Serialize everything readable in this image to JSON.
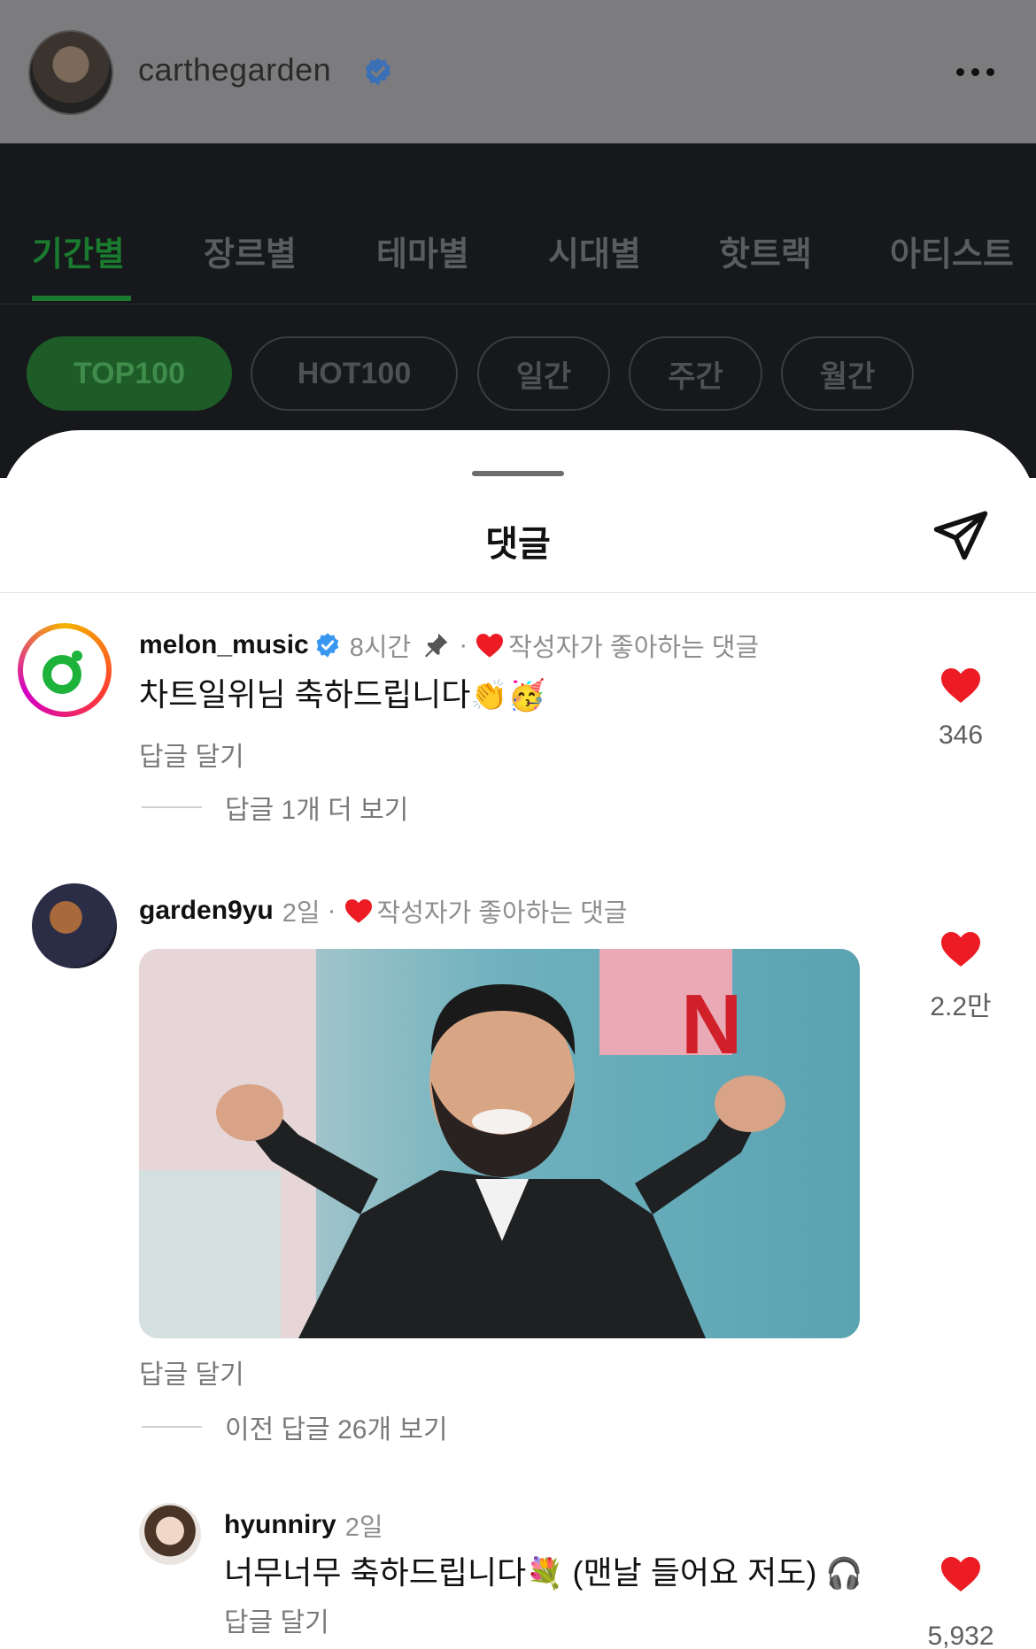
{
  "background": {
    "topbar": {
      "username": "carthegarden"
    },
    "tabs": [
      "기간별",
      "장르별",
      "테마별",
      "시대별",
      "핫트랙",
      "아티스트"
    ],
    "active_tab": 0,
    "pills": [
      "TOP100",
      "HOT100",
      "일간",
      "주간",
      "월간"
    ],
    "active_pill": 0
  },
  "sheet": {
    "title": "댓글"
  },
  "comments": [
    {
      "username": "melon_music",
      "time": "8시간",
      "liked_label": "작성자가 좋아하는 댓글",
      "text": "차트일위님 축하드립니다",
      "emoji": "👏🥳",
      "reply_label": "답글 달기",
      "more_replies": "답글 1개 더 보기",
      "likes": "346"
    },
    {
      "username": "garden9yu",
      "time": "2일",
      "liked_label": "작성자가 좋아하는 댓글",
      "reply_label": "답글 달기",
      "more_replies": "이전 답글 26개 보기",
      "likes": "2.2만"
    },
    {
      "username": "hyunniry",
      "time": "2일",
      "text": "너무너무 축하드립니다",
      "emoji": "💐",
      "text2": " (맨날 들어요 저도) ",
      "emoji2": "🎧",
      "reply_label": "답글 달기",
      "likes": "5,932"
    }
  ],
  "colors": {
    "accent_green": "#1a7a2e",
    "heart_red": "#ed1c24",
    "verified_blue": "#3897f0"
  }
}
